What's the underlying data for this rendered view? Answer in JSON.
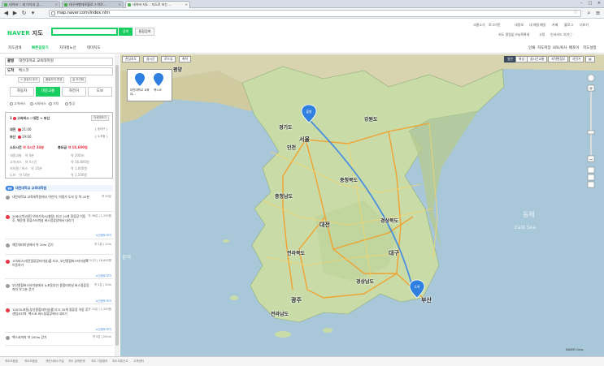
{
  "browser": {
    "tabs": [
      {
        "label": "네이버 :: 새 이식과 공…"
      },
      {
        "label": "대구여행데로블로그 여로…"
      },
      {
        "label": "네이버 지도 : 지도로 보는…"
      }
    ],
    "url": "map.naver.com/index.nhn"
  },
  "header": {
    "logo_main": "NAVER",
    "logo_sub": "지도",
    "search_button": "검색",
    "help_button": "통합검색",
    "top_links": [
      "크롬소식",
      "로그아웃",
      "내정보",
      "내 메일",
      "메일",
      "카페",
      "블로그",
      "더보기"
    ],
    "user_line": "지도 알림없 my목록새 ",
    "user_links": [
      "고정",
      "인서리드 지기ⓘ"
    ]
  },
  "nav": {
    "tabs": [
      "지도검색",
      "빠른길찾기",
      "지하철노선",
      "테마지도"
    ],
    "right_links": [
      "인쇄",
      "지도저장",
      "URL복사",
      "배포이",
      "지도설정"
    ]
  },
  "route": {
    "from_label": "출발",
    "from_value": "대전대학교 교육대학원",
    "to_label": "도착",
    "to_value": "벡스코",
    "buttons": [
      "+ 경유지 추가",
      "출발도착 변경",
      "길 초기화"
    ],
    "modes": [
      "자동차",
      "대중교통",
      "자전거",
      "도보"
    ],
    "options": [
      "고속버스",
      "시외버스",
      "기차",
      "항공"
    ],
    "summary_title": "고속버스 : 대전 → 부산",
    "summary_btn": "자세히보기",
    "depart_label": "대전",
    "depart_time": "21:00",
    "arrive_label": "부산",
    "arrive_time": "19:00",
    "depart_info": "{ 동대구 }",
    "arrive_info": "{ 노포동 }",
    "total_label": "소요시간",
    "total_time": "약 4시간 34분",
    "fare_label": "총요금",
    "fare_value": "약 18,600원",
    "details": [
      {
        "k": "대중교통",
        "v": "약 4분",
        "k2": "동구",
        "v2": "약 200m"
      },
      {
        "k": "고속버스",
        "v": "약 4시간",
        "k2": "",
        "v2": "약 16,800원"
      },
      {
        "k": "지하철 / 버스",
        "v": "약 15분",
        "k2": "",
        "v2": "약 1,000원"
      },
      {
        "k": "도보",
        "v": "약 10분",
        "k2": "",
        "v2": "약 1,500원"
      }
    ],
    "step_tag": "출발",
    "step_head": "대전대학교 교육대학원",
    "steps": [
      {
        "text": "대전대학교 교육대학원에서 여인어, 여정가 도보 당 약 20분 ",
        "meta": "약 50분",
        "link": ""
      },
      {
        "text": "20801번(대전 여자가속시(충정) 타고 10개 정류장 이동 후, 해운대 정류스터미널 버스정류장에서 내리기",
        "meta": "약 36분 | 1,250원",
        "link": "노선정보 보기"
      },
      {
        "text": "해운대터미널에서 약 10m 걷기",
        "meta": "약 1분 | 10m",
        "link": ""
      },
      {
        "text": "고속버스(대전정류장터미널)를 타고, 부산종합버스터미널로 이동하기",
        "meta": "약 3시간 | 16,800원",
        "link": "노선정보 보기"
      },
      {
        "text": "부산종합버스터미널에서 노포동부산 종합터미널 버스정류장까지 약 2분 걷기",
        "meta": "약 1분 | 50m",
        "link": "노선정보 보기"
      },
      {
        "text": "1003노포동(부산종합터미널)를 타고 35개 정류장 이동 후, 센텀시티역, 벡스코 버스정류장에서 내리기",
        "meta": "약 31분 | 1,250원",
        "link": "노선정보 보기"
      },
      {
        "text": "벡스코까지 약 200m 걷기",
        "meta": "약 5분 | 200m",
        "link": ""
      }
    ]
  },
  "map": {
    "top_buttons": [
      "관심지도",
      "실시간",
      "로드뷰",
      "축척"
    ],
    "right_buttons": [
      "일반",
      "위성",
      "실시간교통",
      "지적편집도",
      "자전거"
    ],
    "legend_a": "대전대학교 교육대...",
    "legend_b": "벡스코",
    "marker_start": "출발",
    "marker_end": "도착",
    "labels": {
      "pyongyang": "평양",
      "gangwon": "강원도",
      "gyeonggi": "경기도",
      "seoul": "서울",
      "incheon": "인천",
      "chungbuk": "충청북도",
      "chungnam": "충청남도",
      "gyeongbuk": "경상북도",
      "daejeon": "대전",
      "jeonbuk": "전라북도",
      "daegu": "대구",
      "gyeongnam": "경상남도",
      "gwangju": "광주",
      "jeonnam": "전라남도",
      "busan": "부산",
      "east_sea_ko": "동해",
      "east_sea_en": "East Sea",
      "yellow_sea": "황해"
    },
    "copyright": "NAVER Corp."
  },
  "status_links": [
    "지도도움말",
    "지도도움말",
    "개인서비스가입",
    "지도 검색문제 ",
    "지도 기업정보",
    "지도오류신고",
    "고객센터"
  ]
}
